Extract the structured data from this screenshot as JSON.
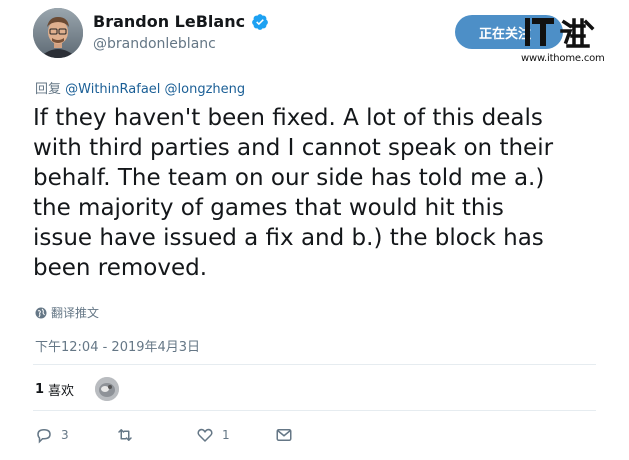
{
  "tweet": {
    "author_name": "Brandon LeBlanc",
    "author_handle": "@brandonleblanc",
    "follow_label": "正在关注",
    "reply_prefix": "回复",
    "reply_mentions": "@WithinRafael @longzheng",
    "text_lines": [
      "If they haven't been fixed. A lot of this deals",
      "with third parties and I cannot speak on their",
      "behalf. The team on our side has told me a.)",
      "the majority of games that would hit this",
      "issue have issued a fix and b.) the block has",
      "been removed."
    ],
    "translate_label": "翻译推文",
    "timestamp": "下午12:04 - 2019年4月3日",
    "likes_count": "1",
    "likes_label": "喜欢",
    "actions": {
      "reply_count": "3",
      "retweet_count": "",
      "like_count": "1"
    }
  },
  "watermark": {
    "logo_text": "IT之家",
    "url": "www.ithome.com"
  },
  "colors": {
    "text": "#14171a",
    "muted": "#657786",
    "link": "#1b5f96",
    "verified": "#1da1f2",
    "follow_bg": "#4d8fc7",
    "divider": "#e6ecf0"
  },
  "icons": [
    "verified-badge-icon",
    "globe-icon",
    "reply-icon",
    "retweet-icon",
    "heart-icon",
    "mail-icon"
  ]
}
